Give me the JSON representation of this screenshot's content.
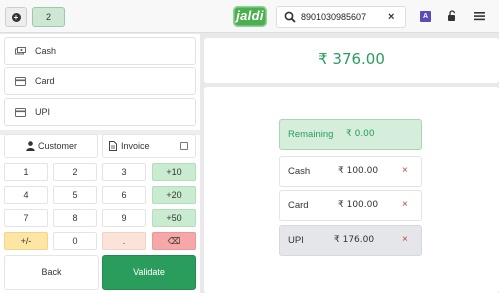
{
  "topbar": {
    "order_number": "2",
    "logo_text": "jaldi",
    "search_value": "8901030985607",
    "clear_label": "×",
    "user_badge": "A"
  },
  "payment_methods": [
    {
      "label": "Cash",
      "icon": "cash-icon"
    },
    {
      "label": "Card",
      "icon": "card-icon"
    },
    {
      "label": "UPI",
      "icon": "upi-icon"
    }
  ],
  "actions": {
    "customer_label": "Customer",
    "invoice_label": "Invoice",
    "invoice_checked": false
  },
  "keypad": [
    [
      "1",
      "2",
      "3",
      "+10"
    ],
    [
      "4",
      "5",
      "6",
      "+20"
    ],
    [
      "7",
      "8",
      "9",
      "+50"
    ],
    [
      "+/-",
      "0",
      ".",
      "⌫"
    ]
  ],
  "footer": {
    "back_label": "Back",
    "validate_label": "Validate"
  },
  "summary": {
    "total": "₹ 376.00"
  },
  "payment_lines": {
    "remaining_label": "Remaining",
    "remaining_amount": "₹ 0.00",
    "lines": [
      {
        "method": "Cash",
        "amount": "₹ 100.00",
        "delete": "×"
      },
      {
        "method": "Card",
        "amount": "₹ 100.00",
        "delete": "×"
      },
      {
        "method": "UPI",
        "amount": "₹ 176.00",
        "delete": "×"
      }
    ]
  },
  "colors": {
    "accent_green": "#2a9d5c",
    "logo_green": "#4caf50",
    "delete_red": "#d23a3a",
    "user_badge_bg": "#5b4bb7"
  }
}
